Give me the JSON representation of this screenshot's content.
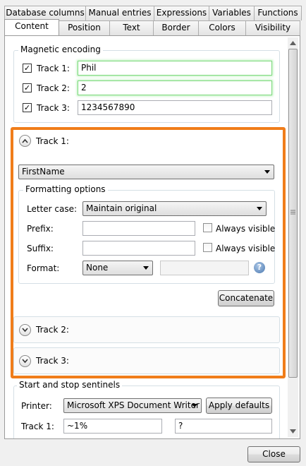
{
  "tabs_top": [
    "Database columns",
    "Manual entries",
    "Expressions",
    "Variables",
    "Functions"
  ],
  "tabs_bottom": [
    "Content",
    "Position",
    "Text",
    "Border",
    "Colors",
    "Visibility"
  ],
  "magnetic": {
    "title": "Magnetic encoding",
    "tracks": [
      {
        "label": "Track 1:",
        "value": "Phil",
        "checked": true
      },
      {
        "label": "Track 2:",
        "value": "2",
        "checked": true
      },
      {
        "label": "Track 3:",
        "value": "1234567890",
        "checked": true
      }
    ]
  },
  "track1": {
    "header": "Track 1:",
    "field_combo": "FirstName",
    "formatting": {
      "title": "Formatting options",
      "letter_case_label": "Letter case:",
      "letter_case_value": "Maintain original",
      "prefix_label": "Prefix:",
      "prefix_value": "",
      "suffix_label": "Suffix:",
      "suffix_value": "",
      "always_visible_label": "Always visible",
      "format_label": "Format:",
      "format_value": "None",
      "format_extra": ""
    },
    "concatenate_label": "Concatenate"
  },
  "track2_header": "Track 2:",
  "track3_header": "Track 3:",
  "sentinels": {
    "title": "Start and stop sentinels",
    "printer_label": "Printer:",
    "printer_value": "Microsoft XPS Document Writer",
    "apply_defaults_label": "Apply defaults",
    "track1_label": "Track 1:",
    "track1_start": "~1%",
    "track1_stop": "?"
  },
  "close_label": "Close",
  "help_glyph": "?",
  "accent_color": "#f07d1a",
  "icons": [
    "chevron-up-icon",
    "chevron-down-icon",
    "help-icon",
    "dropdown-arrow-icon"
  ]
}
